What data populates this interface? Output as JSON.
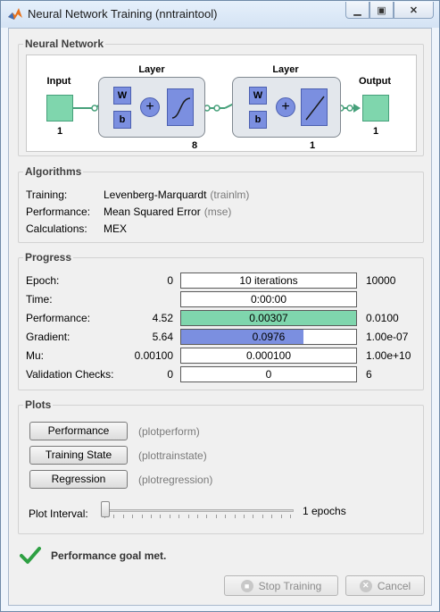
{
  "window": {
    "title": "Neural Network Training (nntraintool)"
  },
  "neural_network": {
    "section_title": "Neural Network",
    "input": {
      "label": "Input",
      "size": "1"
    },
    "layer1": {
      "label": "Layer",
      "size": "8",
      "w_label": "W",
      "b_label": "b"
    },
    "layer2": {
      "label": "Layer",
      "size": "1",
      "w_label": "W",
      "b_label": "b"
    },
    "output": {
      "label": "Output",
      "size": "1"
    }
  },
  "algorithms": {
    "section_title": "Algorithms",
    "rows": [
      {
        "label": "Training:",
        "value": "Levenberg-Marquardt",
        "note": "(trainlm)"
      },
      {
        "label": "Performance:",
        "value": "Mean Squared Error",
        "note": "(mse)"
      },
      {
        "label": "Calculations:",
        "value": "MEX",
        "note": ""
      }
    ]
  },
  "progress": {
    "section_title": "Progress",
    "rows": [
      {
        "label": "Epoch:",
        "min": "0",
        "value": "10 iterations",
        "max": "10000",
        "fill": 0.0,
        "color": "#7fd6ad"
      },
      {
        "label": "Time:",
        "min": "",
        "value": "0:00:00",
        "max": "",
        "fill": 0.0,
        "color": "#7fd6ad"
      },
      {
        "label": "Performance:",
        "min": "4.52",
        "value": "0.00307",
        "max": "0.0100",
        "fill": 1.0,
        "color": "#7fd6ad"
      },
      {
        "label": "Gradient:",
        "min": "5.64",
        "value": "0.0976",
        "max": "1.00e-07",
        "fill": 0.7,
        "color": "#7b8fe0"
      },
      {
        "label": "Mu:",
        "min": "0.00100",
        "value": "0.000100",
        "max": "1.00e+10",
        "fill": 0.0,
        "color": "#7b8fe0"
      },
      {
        "label": "Validation Checks:",
        "min": "0",
        "value": "0",
        "max": "6",
        "fill": 0.0,
        "color": "#7b8fe0"
      }
    ]
  },
  "plots": {
    "section_title": "Plots",
    "buttons": [
      {
        "label": "Performance",
        "fn": "(plotperform)"
      },
      {
        "label": "Training State",
        "fn": "(plottrainstate)"
      },
      {
        "label": "Regression",
        "fn": "(plotregression)"
      }
    ],
    "interval_label": "Plot Interval:",
    "interval_value": "1 epochs",
    "interval_slider": 0.0
  },
  "status": {
    "message": "Performance goal met."
  },
  "footer": {
    "stop_label": "Stop Training",
    "cancel_label": "Cancel"
  },
  "colors": {
    "accent_green": "#7fd6ad",
    "accent_blue": "#7b8fe0",
    "check_green": "#2ea043"
  },
  "icons": [
    "matlab-logo-icon",
    "minimize-icon",
    "maximize-icon",
    "close-icon",
    "checkmark-icon",
    "stop-icon",
    "cancel-icon"
  ]
}
